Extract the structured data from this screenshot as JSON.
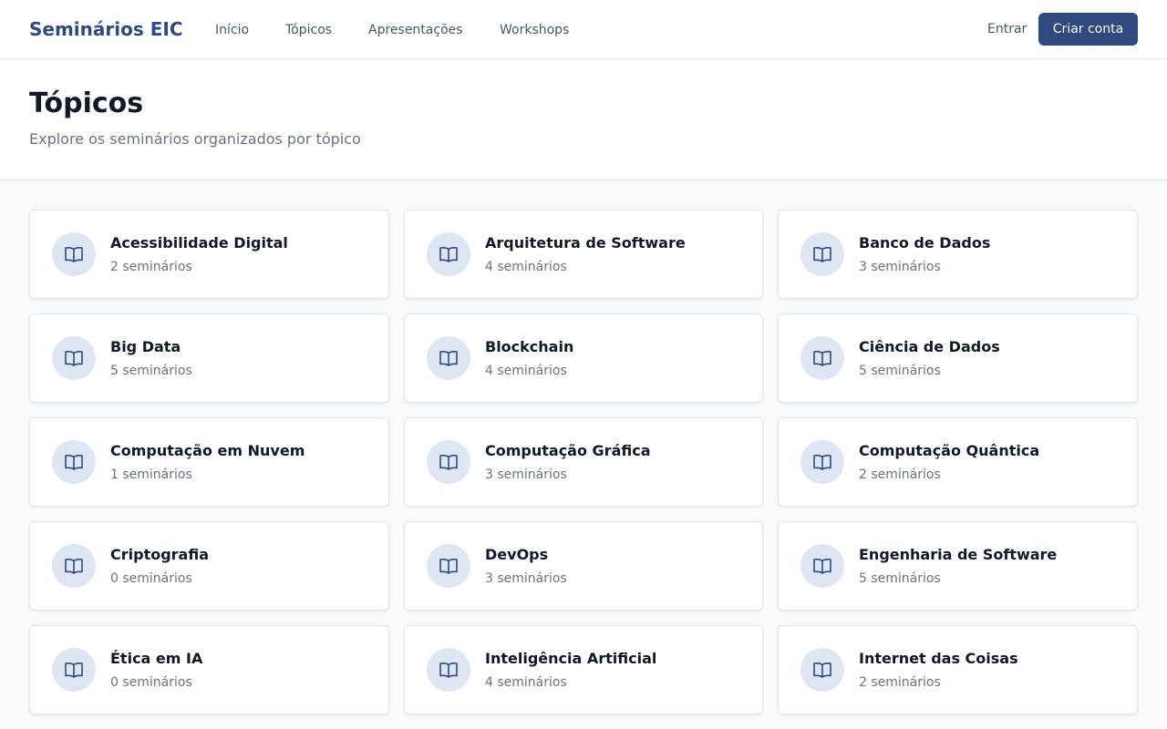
{
  "nav": {
    "brand": "Seminários EIC",
    "links": [
      "Início",
      "Tópicos",
      "Apresentações",
      "Workshops"
    ],
    "login_label": "Entrar",
    "signup_label": "Criar conta"
  },
  "header": {
    "title": "Tópicos",
    "subtitle": "Explore os seminários organizados por tópico"
  },
  "topics": [
    {
      "name": "Acessibilidade Digital",
      "count": "2 seminários"
    },
    {
      "name": "Arquitetura de Software",
      "count": "4 seminários"
    },
    {
      "name": "Banco de Dados",
      "count": "3 seminários"
    },
    {
      "name": "Big Data",
      "count": "5 seminários"
    },
    {
      "name": "Blockchain",
      "count": "4 seminários"
    },
    {
      "name": "Ciência de Dados",
      "count": "5 seminários"
    },
    {
      "name": "Computação em Nuvem",
      "count": "1 seminários"
    },
    {
      "name": "Computação Gráfica",
      "count": "3 seminários"
    },
    {
      "name": "Computação Quântica",
      "count": "2 seminários"
    },
    {
      "name": "Criptografia",
      "count": "0 seminários"
    },
    {
      "name": "DevOps",
      "count": "3 seminários"
    },
    {
      "name": "Engenharia de Software",
      "count": "5 seminários"
    },
    {
      "name": "Ética em IA",
      "count": "0 seminários"
    },
    {
      "name": "Inteligência Artificial",
      "count": "4 seminários"
    },
    {
      "name": "Internet das Coisas",
      "count": "2 seminários"
    }
  ],
  "icons": {
    "topic_icon": "book-open-icon"
  },
  "colors": {
    "brand": "#2f4a7f",
    "icon_bg": "#dfe6f3"
  }
}
